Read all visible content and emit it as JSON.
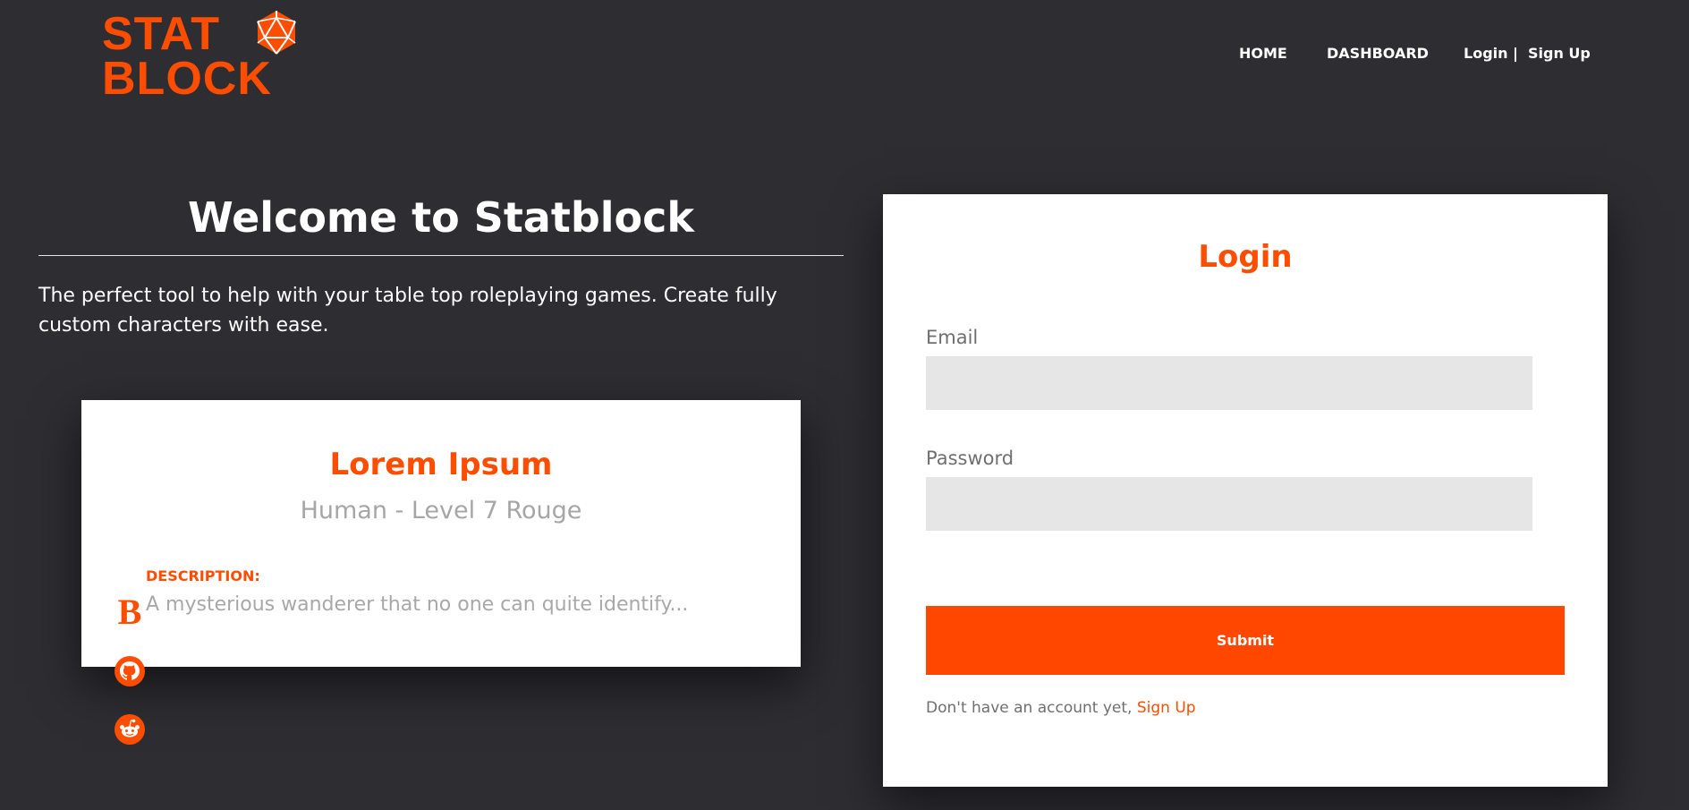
{
  "brand": {
    "line1": "STAT",
    "line2": "BLOCK"
  },
  "nav": {
    "home": "HOME",
    "dashboard": "DASHBOARD",
    "login": "Login",
    "separator": "|",
    "signup": "Sign Up"
  },
  "hero": {
    "title": "Welcome to Statblock",
    "text": "The perfect tool to help with your table top roleplaying games. Create fully custom characters with ease."
  },
  "character_card": {
    "name": "Lorem Ipsum",
    "subtitle": "Human - Level 7 Rouge",
    "description_label": "DESCRIPTION:",
    "description": "A mysterious wanderer that no one can quite identify..."
  },
  "social": {
    "icons": [
      "b-logo-icon",
      "github-icon",
      "reddit-icon"
    ]
  },
  "login": {
    "title": "Login",
    "email_label": "Email",
    "email_value": "",
    "password_label": "Password",
    "password_value": "",
    "submit_label": "Submit",
    "signup_prompt": "Don't have an account yet, ",
    "signup_link": "Sign Up"
  },
  "colors": {
    "background": "#2d2d32",
    "accent": "#ff4d00",
    "field_bg": "#e6e6e6"
  }
}
